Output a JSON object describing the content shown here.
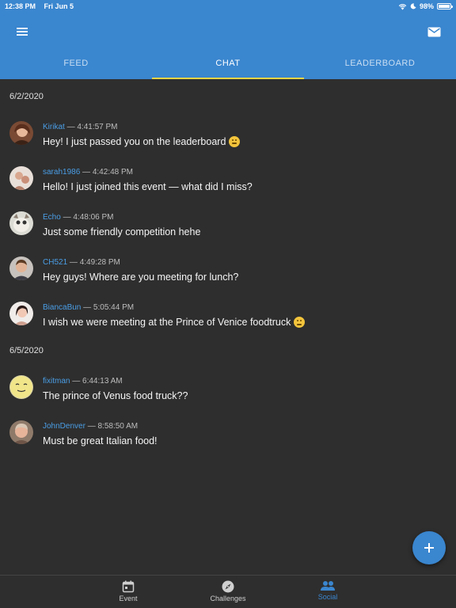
{
  "status_bar": {
    "time": "12:38 PM",
    "date": "Fri Jun 5",
    "battery": "98%",
    "battery_level": 0.98
  },
  "app_bar": {
    "menu_icon": "hamburger-menu-icon",
    "mail_icon": "mail-icon"
  },
  "tabs": [
    {
      "label": "FEED",
      "active": false
    },
    {
      "label": "CHAT",
      "active": true
    },
    {
      "label": "LEADERBOARD",
      "active": false
    }
  ],
  "chat": {
    "groups": [
      {
        "date": "6/2/2020",
        "messages": [
          {
            "user": "Kirikat",
            "time": "— 4:41:57 PM",
            "text": "Hey! I just passed you on the leaderboard",
            "emoji": "grinning-face-emoji"
          },
          {
            "user": "sarah1986",
            "time": "— 4:42:48 PM",
            "text": "Hello! I just joined this event — what did I miss?"
          },
          {
            "user": "Echo",
            "time": "— 4:48:06 PM",
            "text": "Just some friendly competition hehe"
          },
          {
            "user": "CH521",
            "time": "— 4:49:28 PM",
            "text": "Hey guys! Where are you meeting for lunch?"
          },
          {
            "user": "BiancaBun",
            "time": "— 5:05:44 PM",
            "text": "I wish we were meeting at the Prince of Venice foodtruck",
            "emoji": "pensive-face-emoji"
          }
        ]
      },
      {
        "date": "6/5/2020",
        "messages": [
          {
            "user": "fixitman",
            "time": "— 6:44:13 AM",
            "text": "The prince of Venus food truck??"
          },
          {
            "user": "JohnDenver",
            "time": "— 8:58:50 AM",
            "text": "Must be great Italian food!"
          }
        ]
      }
    ]
  },
  "fab": {
    "icon": "plus-icon"
  },
  "bottom_nav": [
    {
      "label": "Event",
      "icon": "calendar-icon",
      "active": false
    },
    {
      "label": "Challenges",
      "icon": "compass-icon",
      "active": false
    },
    {
      "label": "Social",
      "icon": "people-icon",
      "active": true
    }
  ],
  "colors": {
    "primary": "#3a86cf",
    "background": "#2e2e2e",
    "tab_indicator": "#f5d547",
    "username": "#4a9ee6"
  }
}
